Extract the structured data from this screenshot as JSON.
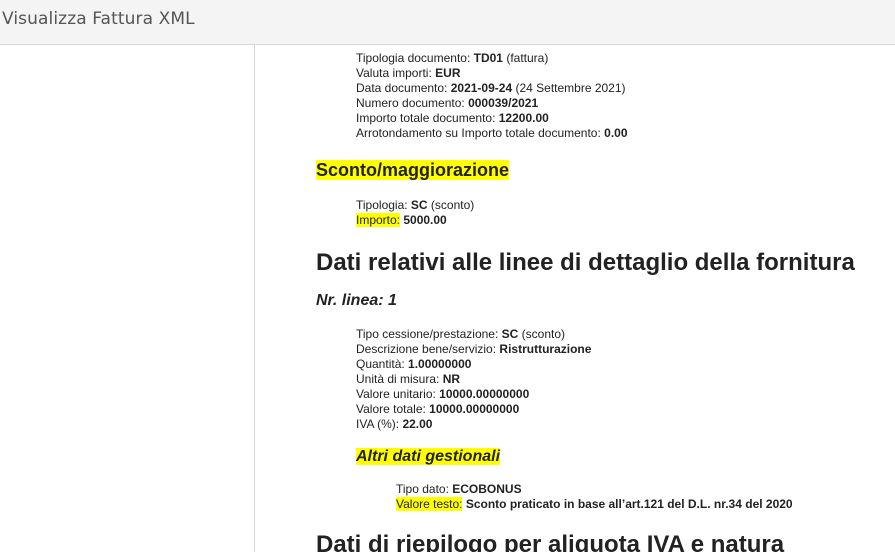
{
  "window": {
    "title": "Visualizza Fattura XML"
  },
  "document": {
    "general": [
      {
        "label": "Tipologia documento: ",
        "value": "TD01",
        "extra": " (fattura)"
      },
      {
        "label": "Valuta importi: ",
        "value": "EUR",
        "extra": ""
      },
      {
        "label": "Data documento: ",
        "value": "2021-09-24",
        "extra": " (24 Settembre 2021)"
      },
      {
        "label": "Numero documento: ",
        "value": "000039/2021",
        "extra": ""
      },
      {
        "label": "Importo totale documento: ",
        "value": "12200.00",
        "extra": ""
      },
      {
        "label": "Arrotondamento su Importo totale documento: ",
        "value": "0.00",
        "extra": ""
      }
    ],
    "discount_heading": "Sconto/maggiorazione",
    "discount": [
      {
        "label": "Tipologia: ",
        "value": "SC",
        "extra": " (sconto)"
      },
      {
        "label": "Importo:",
        "value": " 5000.00",
        "extra": ""
      }
    ],
    "lines_heading": "Dati relativi alle linee di dettaglio della fornitura",
    "line_heading": "Nr. linea: 1",
    "line": [
      {
        "label": "Tipo cessione/prestazione: ",
        "value": "SC",
        "extra": " (sconto)"
      },
      {
        "label": "Descrizione bene/servizio: ",
        "value": "Ristrutturazione",
        "extra": ""
      },
      {
        "label": "Quantità: ",
        "value": "1.00000000",
        "extra": ""
      },
      {
        "label": "Unità di misura: ",
        "value": "NR",
        "extra": ""
      },
      {
        "label": "Valore unitario: ",
        "value": "10000.00000000",
        "extra": ""
      },
      {
        "label": "Valore totale: ",
        "value": "10000.00000000",
        "extra": ""
      },
      {
        "label": "IVA (%): ",
        "value": "22.00",
        "extra": ""
      }
    ],
    "mgmt_heading": "Altri dati gestionali",
    "mgmt": [
      {
        "label": "Tipo dato: ",
        "value": "ECOBONUS",
        "extra": ""
      },
      {
        "label": "Valore testo:",
        "value": " Sconto praticato in base all’art.121 del D.L. nr.34 del 2020",
        "extra": ""
      }
    ],
    "summary_heading": "Dati di riepilogo per aliquota IVA e natura"
  }
}
